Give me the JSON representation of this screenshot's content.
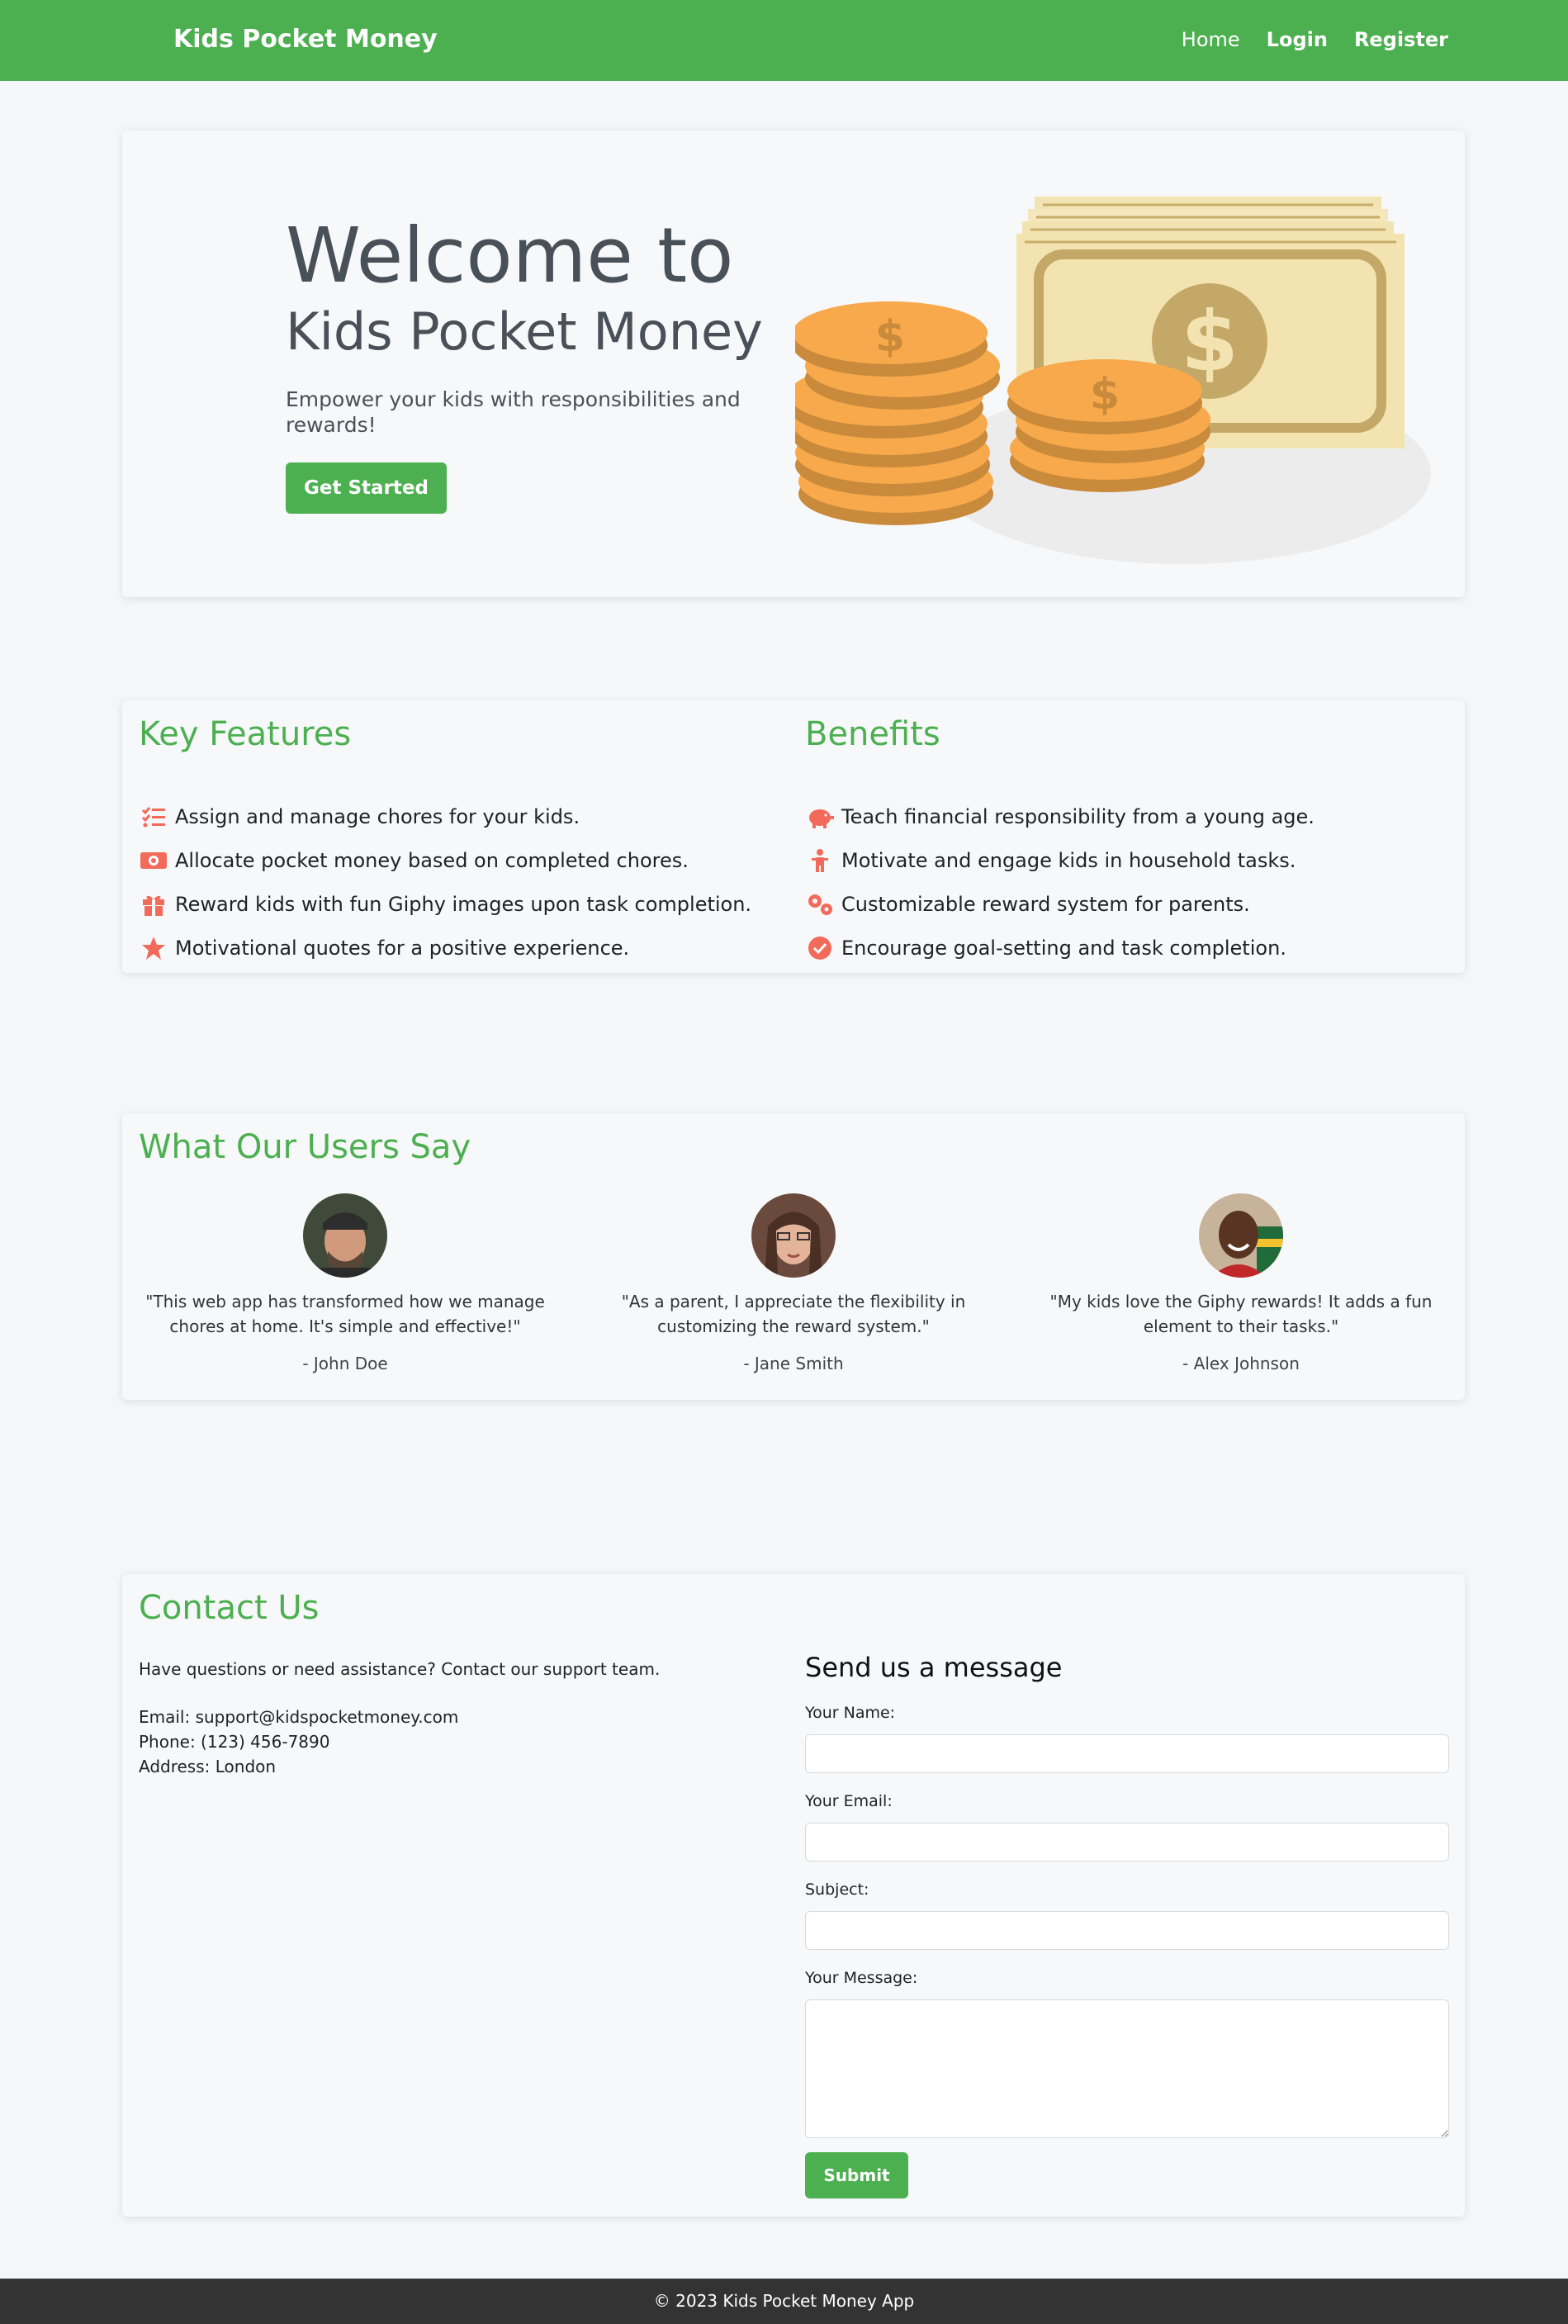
{
  "navbar": {
    "brand": "Kids Pocket Money",
    "links": [
      "Home",
      "Login",
      "Register"
    ]
  },
  "hero": {
    "title": "Welcome to",
    "subtitle": "Kids Pocket Money",
    "text": "Empower your kids with responsibilities and rewards!",
    "button": "Get Started",
    "illustration_icon": "money-coins-illustration"
  },
  "features": {
    "title": "Key Features",
    "items": [
      {
        "icon": "tasks-icon",
        "text": "Assign and manage chores for your kids."
      },
      {
        "icon": "money-bill-icon",
        "text": "Allocate pocket money based on completed chores."
      },
      {
        "icon": "gift-icon",
        "text": "Reward kids with fun Giphy images upon task completion."
      },
      {
        "icon": "star-icon",
        "text": "Motivational quotes for a positive experience."
      }
    ]
  },
  "benefits": {
    "title": "Benefits",
    "items": [
      {
        "icon": "piggy-bank-icon",
        "text": "Teach financial responsibility from a young age."
      },
      {
        "icon": "child-icon",
        "text": "Motivate and engage kids in household tasks."
      },
      {
        "icon": "cogs-icon",
        "text": "Customizable reward system for parents."
      },
      {
        "icon": "check-circle-icon",
        "text": "Encourage goal-setting and task completion."
      }
    ]
  },
  "testimonials": {
    "title": "What Our Users Say",
    "items": [
      {
        "quote": "\"This web app has transformed how we manage chores at home. It's simple and effective!\"",
        "author": "- John Doe"
      },
      {
        "quote": "\"As a parent, I appreciate the flexibility in customizing the reward system.\"",
        "author": "- Jane Smith"
      },
      {
        "quote": "\"My kids love the Giphy rewards! It adds a fun element to their tasks.\"",
        "author": "- Alex Johnson"
      }
    ]
  },
  "contact": {
    "title": "Contact Us",
    "text": "Have questions or need assistance? Contact our support team.",
    "email": "Email: support@kidspocketmoney.com",
    "phone": "Phone: (123) 456-7890",
    "address": "Address: London",
    "form": {
      "title": "Send us a message",
      "name_label": "Your Name:",
      "email_label": "Your Email:",
      "subject_label": "Subject:",
      "message_label": "Your Message:",
      "submit": "Submit"
    }
  },
  "footer": {
    "text": "© 2023 Kids Pocket Money App"
  },
  "colors": {
    "primary": "#4caf50",
    "icon": "#f26a5a",
    "footer": "#333333"
  }
}
